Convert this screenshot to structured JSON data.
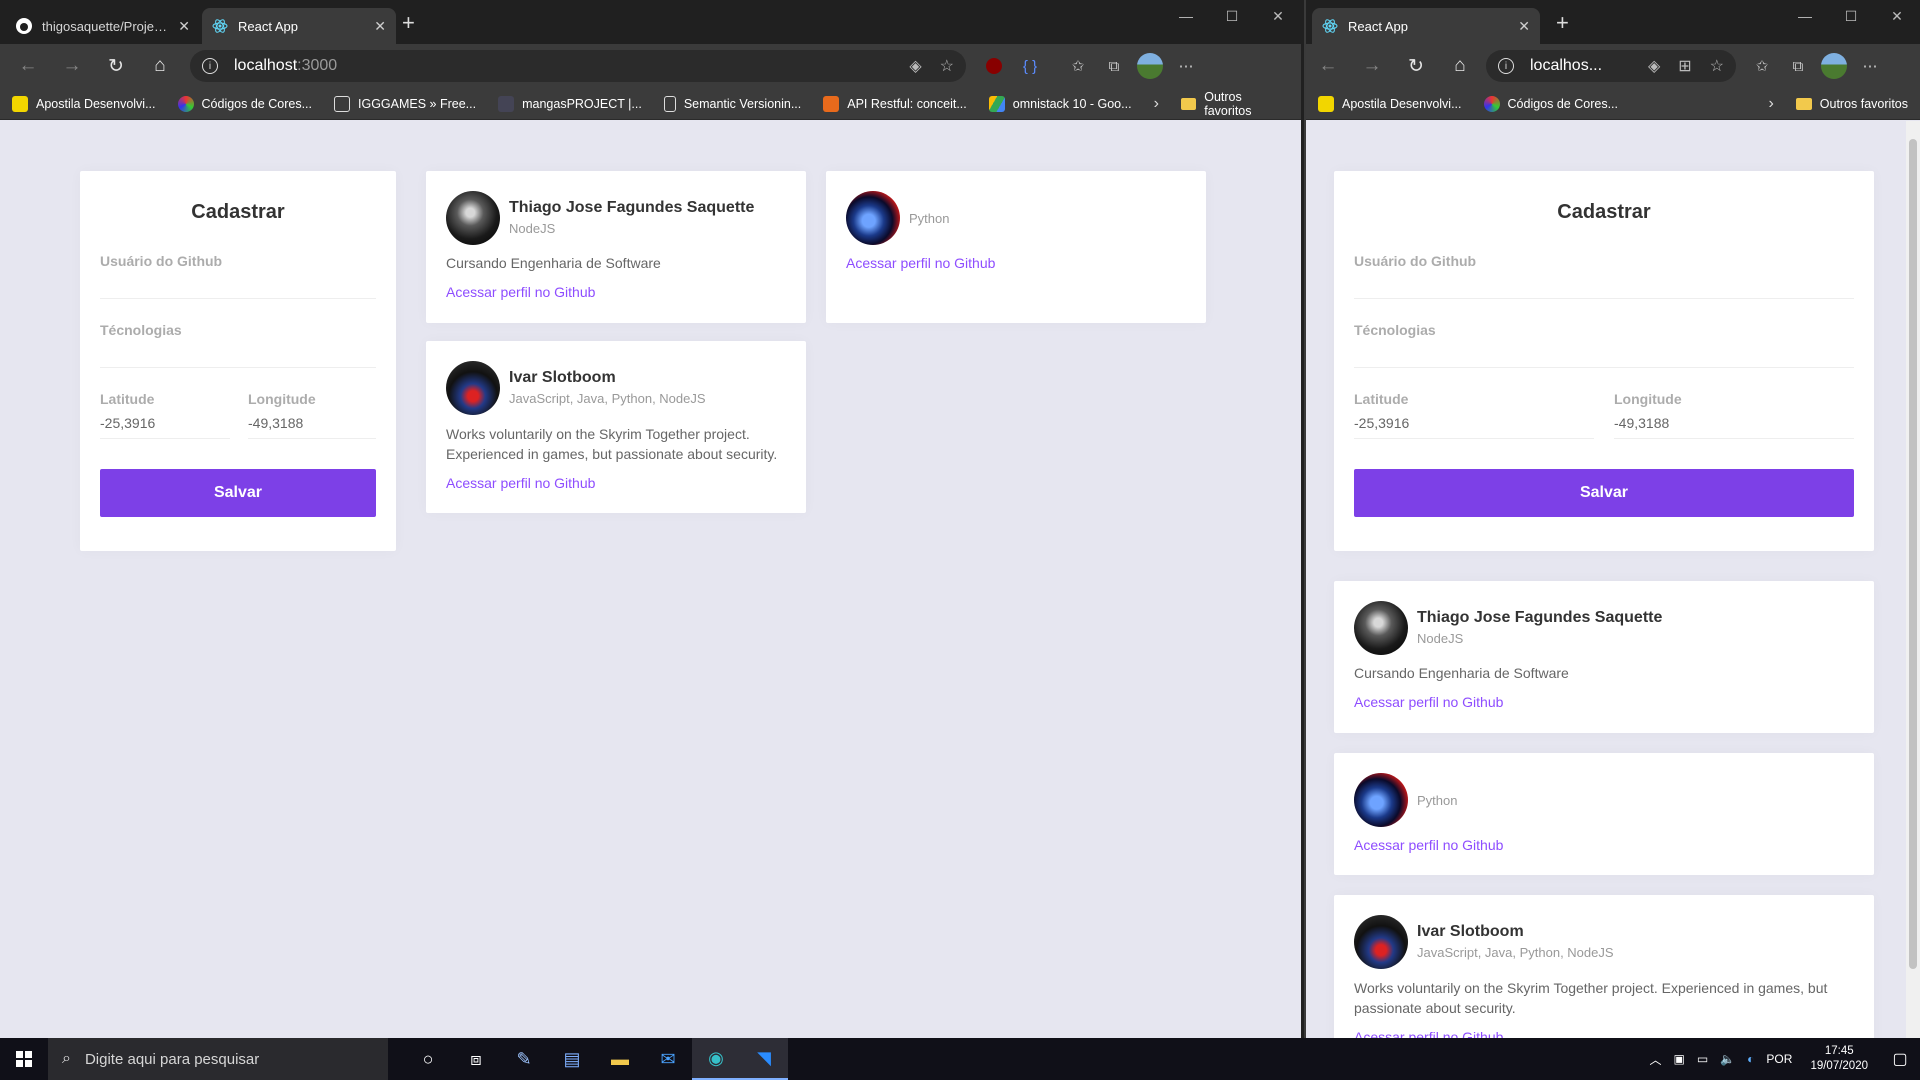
{
  "browserA": {
    "tabs": [
      {
        "title": "thigosaquette/ProjetoO: Projeto",
        "icon": "github-icon",
        "active": false
      },
      {
        "title": "React App",
        "icon": "react-icon",
        "active": true
      }
    ],
    "address": {
      "host": "localhost",
      "port": ":3000"
    },
    "bookmarks": [
      {
        "label": "Apostila Desenvolvi..."
      },
      {
        "label": "Códigos de Cores..."
      },
      {
        "label": "IGGGAMES » Free..."
      },
      {
        "label": "mangasPROJECT |..."
      },
      {
        "label": "Semantic Versionin..."
      },
      {
        "label": "API Restful: conceit..."
      },
      {
        "label": "omnistack 10 - Goo..."
      }
    ],
    "other_favorites": "Outros favoritos"
  },
  "browserB": {
    "tabs": [
      {
        "title": "React App",
        "icon": "react-icon",
        "active": true
      }
    ],
    "address": {
      "host": "localhos..."
    },
    "bookmarks": [
      {
        "label": "Apostila Desenvolvi..."
      },
      {
        "label": "Códigos de Cores..."
      }
    ],
    "other_favorites": "Outros favoritos"
  },
  "form": {
    "title": "Cadastrar",
    "github_label": "Usuário do Github",
    "github_value": "",
    "techs_label": "Técnologias",
    "techs_value": "",
    "latitude_label": "Latitude",
    "latitude_value": "-25,3916",
    "longitude_label": "Longitude",
    "longitude_value": "-49,3188",
    "save_label": "Salvar"
  },
  "devs": [
    {
      "name": "Thiago Jose Fagundes Saquette",
      "techs": "NodeJS",
      "bio": "Cursando Engenharia de Software",
      "link": "Acessar perfil no Github"
    },
    {
      "name": "",
      "techs": "Python",
      "bio": "",
      "link": "Acessar perfil no Github"
    },
    {
      "name": "Ivar Slotboom",
      "techs": "JavaScript, Java, Python, NodeJS",
      "bio": "Works voluntarily on the Skyrim Together project. Experienced in games, but passionate about security.",
      "link": "Acessar perfil no Github"
    }
  ],
  "colors": {
    "primary": "#7d40e7",
    "link": "#8e4dff",
    "background": "#e6e6f0"
  },
  "taskbar": {
    "search_placeholder": "Digite aqui para pesquisar",
    "language": "POR",
    "time": "17:45",
    "date": "19/07/2020"
  }
}
